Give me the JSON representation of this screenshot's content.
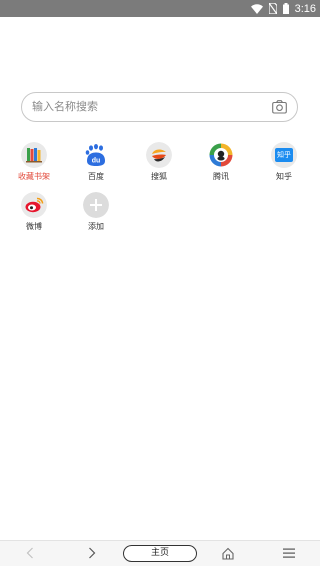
{
  "status_bar": {
    "time": "3:16"
  },
  "search": {
    "placeholder": "输入名称搜索"
  },
  "sites": [
    {
      "label": "收藏书架"
    },
    {
      "label": "百度"
    },
    {
      "label": "搜狐"
    },
    {
      "label": "腾讯"
    },
    {
      "label": "知乎"
    },
    {
      "label": "微博"
    },
    {
      "label": "添加"
    }
  ],
  "zhihu_icon_text": "知乎",
  "baidu_icon_text": "du",
  "bottom_bar": {
    "home_label": "主页"
  },
  "colors": {
    "status_bar_bg": "#7b7b7b",
    "shelf_label": "#e24a3b",
    "baidu_blue": "#2d6ee0",
    "zhihu_blue": "#1b8cf0",
    "weibo_red": "#e6162d"
  }
}
